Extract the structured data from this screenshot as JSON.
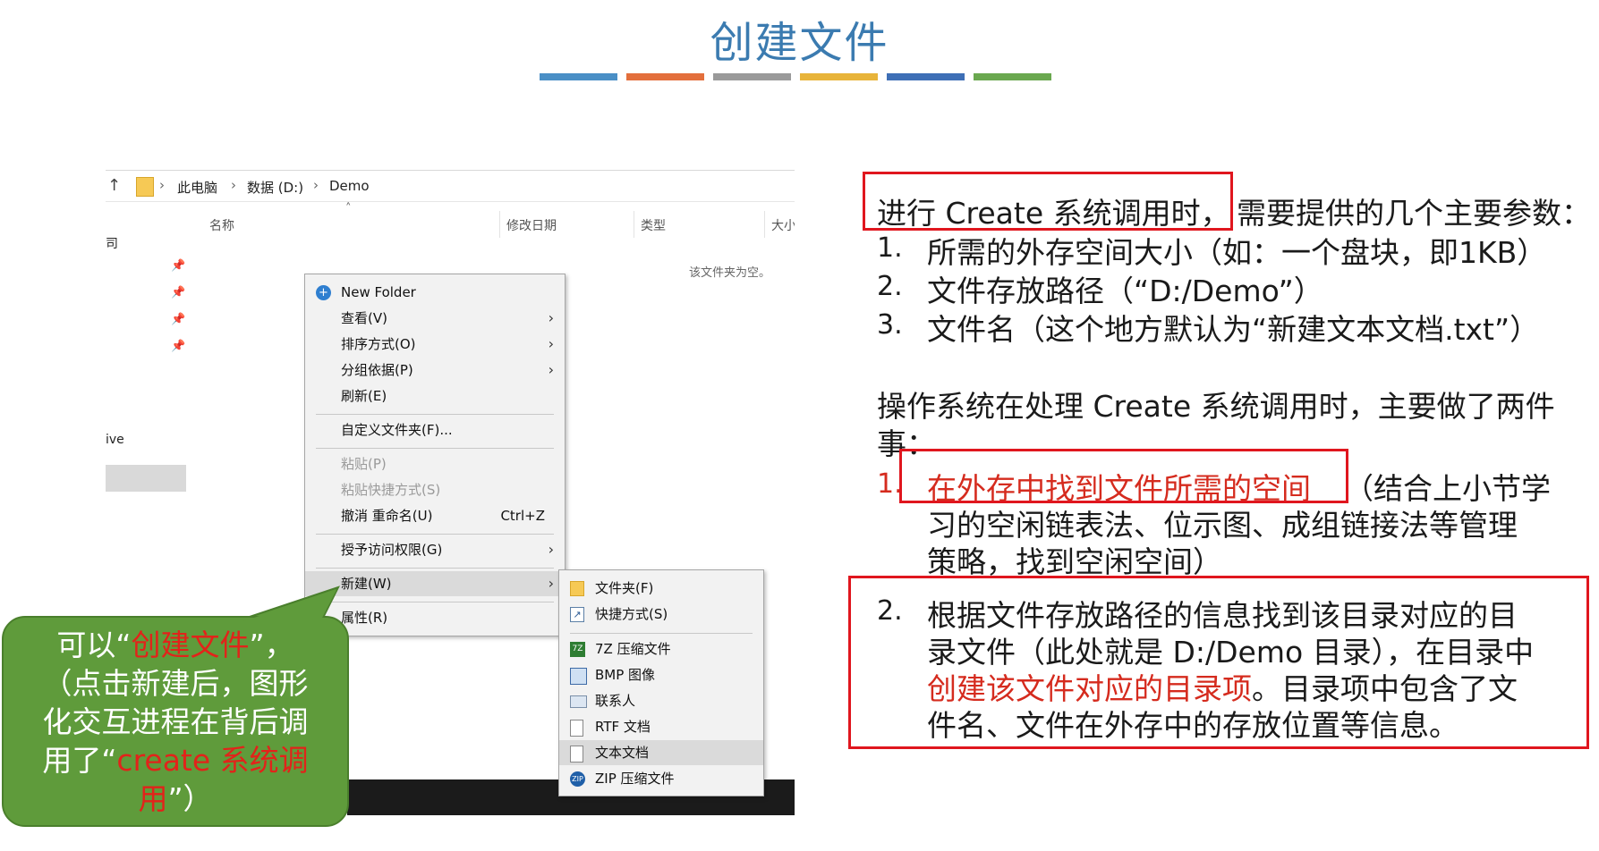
{
  "slide": {
    "watermark": "",
    "title": "创建文件",
    "title_bar_colors": [
      "#4a8fc6",
      "#e36f3c",
      "#9a9a9a",
      "#e8b43a",
      "#3e6fb6",
      "#6aa84f"
    ]
  },
  "explorer": {
    "breadcrumb": [
      "此电脑",
      "数据 (D:)",
      "Demo"
    ],
    "columns": [
      "名称",
      "修改日期",
      "类型",
      "大小"
    ],
    "left_nav_stub_1": "司",
    "left_nav_stub_2": "ive",
    "empty_message": "该文件夹为空。"
  },
  "context_menu": {
    "items": [
      {
        "label": "New Folder",
        "icon": "new-folder-icon"
      },
      {
        "label": "查看(V)",
        "submenu": true
      },
      {
        "label": "排序方式(O)",
        "submenu": true
      },
      {
        "label": "分组依据(P)",
        "submenu": true
      },
      {
        "label": "刷新(E)"
      },
      {
        "label": "自定义文件夹(F)..."
      },
      {
        "label": "粘贴(P)",
        "disabled": true
      },
      {
        "label": "粘贴快捷方式(S)",
        "disabled": true
      },
      {
        "label": "撤消 重命名(U)",
        "shortcut": "Ctrl+Z"
      },
      {
        "label": "授予访问权限(G)",
        "submenu": true
      },
      {
        "label": "新建(W)",
        "submenu": true,
        "highlighted": true
      },
      {
        "label": "属性(R)"
      }
    ]
  },
  "new_submenu": {
    "items": [
      {
        "label": "文件夹(F)",
        "icon": "folder-icon"
      },
      {
        "label": "快捷方式(S)",
        "icon": "shortcut-icon"
      },
      {
        "label": "7Z 压缩文件",
        "icon": "7z-archive-icon"
      },
      {
        "label": "BMP 图像",
        "icon": "bmp-image-icon"
      },
      {
        "label": "联系人",
        "icon": "contact-icon"
      },
      {
        "label": "RTF 文档",
        "icon": "rtf-document-icon"
      },
      {
        "label": "文本文档",
        "icon": "text-document-icon",
        "highlighted": true
      },
      {
        "label": "ZIP 压缩文件",
        "icon": "zip-archive-icon"
      }
    ]
  },
  "callout": {
    "l1_a": "可以“",
    "l1_red": "创建文件",
    "l1_b": "”，",
    "l2": "（点击新建后，图形",
    "l3": "化交互进程在背后调",
    "l4_a": "用了“",
    "l4_red": "create 系统调",
    "l5_red": "用",
    "l5_b": "”）"
  },
  "content": {
    "p1_boxed": "进行 Create 系统调用时，",
    "p1_rest": "需要提供的几个主要参数：",
    "params": [
      {
        "num": "1.",
        "text": "所需的外存空间大小（如：一个盘块，即1KB）"
      },
      {
        "num": "2.",
        "text": "文件存放路径（“D:/Demo”）"
      },
      {
        "num": "3.",
        "text": "文件名（这个地方默认为“新建文本文档.txt”）"
      }
    ],
    "p2_line1": "操作系统在处理 Create 系统调用时，主要做了两件",
    "p2_line2": "事：",
    "step1_num": "1.",
    "step1_red": "在外存中找到文件所需的空间",
    "step1_rest": "（结合上小节学",
    "step1_l2": "习的空闲链表法、位示图、成组链接法等管理",
    "step1_l3": "策略，找到空闲空间）",
    "step2_num": "2.",
    "step2_l1": "根据文件存放路径的信息找到该目录对应的目",
    "step2_l2": "录文件（此处就是 D:/Demo 目录），在目录中",
    "step2_l3_red": "创建该文件对应的目录项",
    "step2_l3_rest": "。目录项中包含了文",
    "step2_l4": "件名、文件在外存中的存放位置等信息。"
  }
}
